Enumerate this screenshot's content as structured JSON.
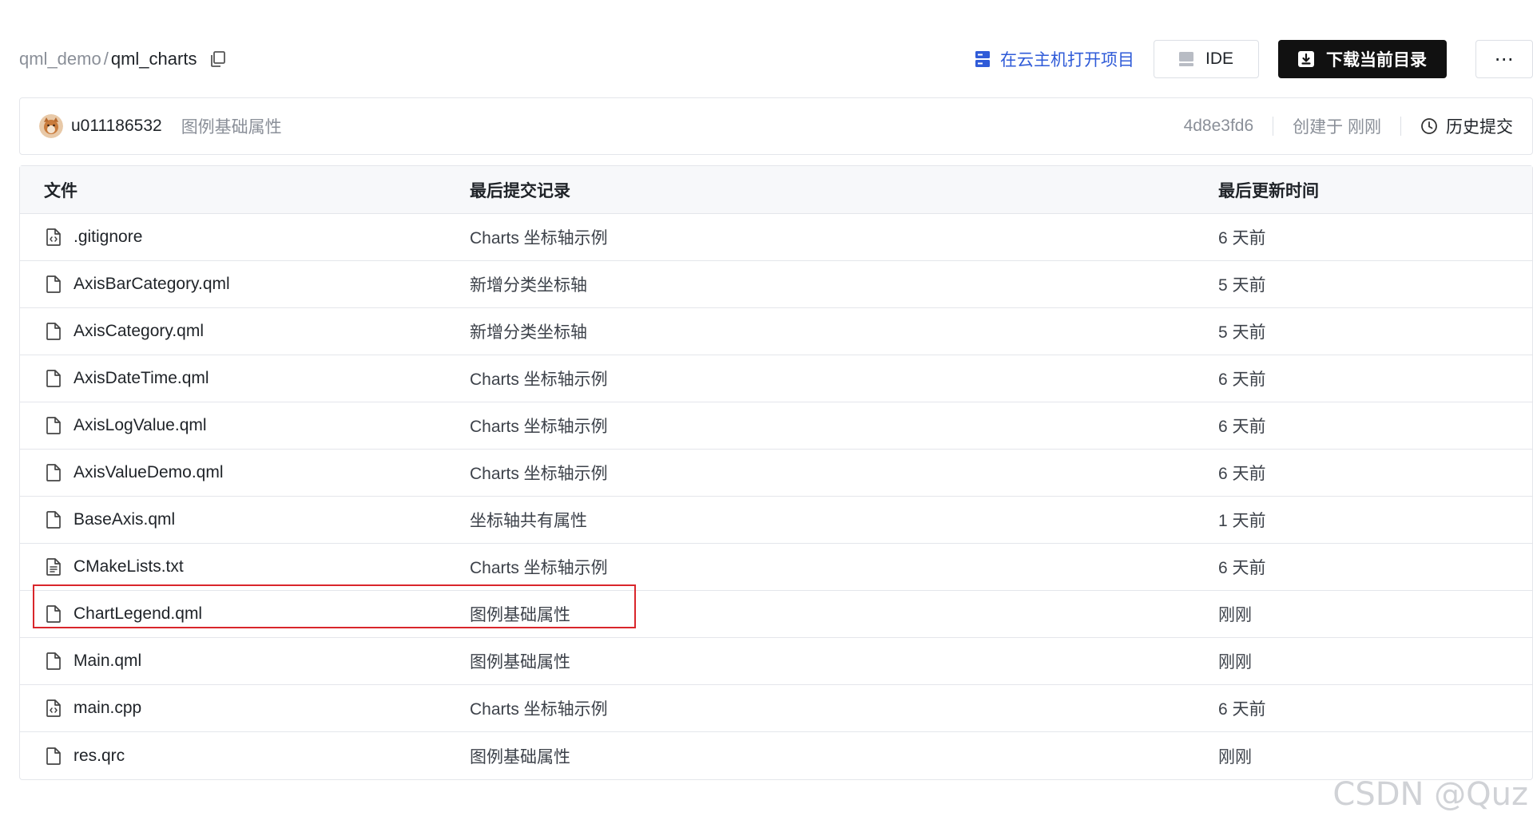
{
  "breadcrumb": {
    "parent": "qml_demo",
    "separator": "/",
    "current": "qml_charts"
  },
  "actions": {
    "cloud_open": "在云主机打开项目",
    "ide": "IDE",
    "download": "下载当前目录",
    "more": "⋯"
  },
  "commit": {
    "author": "u011186532",
    "message": "图例基础属性",
    "hash": "4d8e3fd6",
    "created": "创建于 刚刚",
    "history": "历史提交"
  },
  "table": {
    "headers": {
      "file": "文件",
      "commit": "最后提交记录",
      "time": "最后更新时间"
    },
    "rows": [
      {
        "name": ".gitignore",
        "commit": "Charts 坐标轴示例",
        "time": "6 天前",
        "icon": "code-file-icon"
      },
      {
        "name": "AxisBarCategory.qml",
        "commit": "新增分类坐标轴",
        "time": "5 天前",
        "icon": "file-icon"
      },
      {
        "name": "AxisCategory.qml",
        "commit": "新增分类坐标轴",
        "time": "5 天前",
        "icon": "file-icon"
      },
      {
        "name": "AxisDateTime.qml",
        "commit": "Charts 坐标轴示例",
        "time": "6 天前",
        "icon": "file-icon"
      },
      {
        "name": "AxisLogValue.qml",
        "commit": "Charts 坐标轴示例",
        "time": "6 天前",
        "icon": "file-icon"
      },
      {
        "name": "AxisValueDemo.qml",
        "commit": "Charts 坐标轴示例",
        "time": "6 天前",
        "icon": "file-icon"
      },
      {
        "name": "BaseAxis.qml",
        "commit": "坐标轴共有属性",
        "time": "1 天前",
        "icon": "file-icon"
      },
      {
        "name": "CMakeLists.txt",
        "commit": "Charts 坐标轴示例",
        "time": "6 天前",
        "icon": "text-file-icon"
      },
      {
        "name": "ChartLegend.qml",
        "commit": "图例基础属性",
        "time": "刚刚",
        "icon": "file-icon"
      },
      {
        "name": "Main.qml",
        "commit": "图例基础属性",
        "time": "刚刚",
        "icon": "file-icon"
      },
      {
        "name": "main.cpp",
        "commit": "Charts 坐标轴示例",
        "time": "6 天前",
        "icon": "code-file-icon"
      },
      {
        "name": "res.qrc",
        "commit": "图例基础属性",
        "time": "刚刚",
        "icon": "file-icon"
      }
    ]
  },
  "watermark": "CSDN @Quz",
  "colors": {
    "link": "#2f5bd8",
    "primary_button": "#111111",
    "highlight": "#d9262b"
  }
}
